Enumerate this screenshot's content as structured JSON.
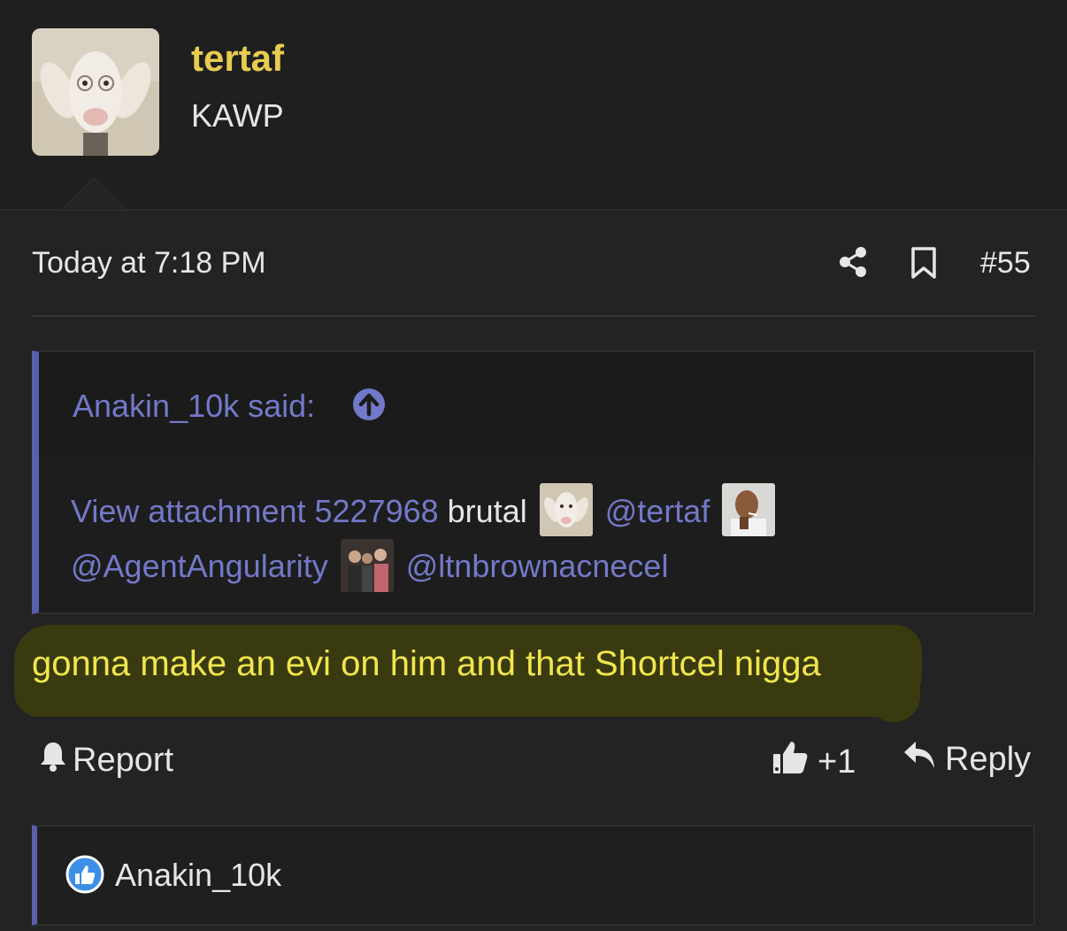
{
  "author": {
    "username": "tertaf",
    "user_title": "KAWP",
    "avatar_icon": "goat-avatar"
  },
  "post": {
    "date": "Today at 7:18 PM",
    "number": "#55",
    "share_icon": "share-icon",
    "bookmark_icon": "bookmark-icon",
    "text": "gonna make an evi on him and that Shortcel nigga"
  },
  "quote": {
    "author_said": "Anakin_10k said:",
    "attachment_link": "View attachment 5227968",
    "text_brutal": "brutal",
    "mention_1": "@tertaf",
    "mention_2": "@AgentAngularity",
    "mention_3": "@ltnbrownacnecel"
  },
  "actions": {
    "report_label": "Report",
    "like_count": "+1",
    "reply_label": "Reply"
  },
  "reactions": {
    "user": "Anakin_10k",
    "icon": "thumbs-up-icon"
  },
  "colors": {
    "background": "#232323",
    "username": "#e8cc4f",
    "link": "#7379c9",
    "highlight_text": "#f0e64d",
    "quote_border": "#5a5fae"
  }
}
